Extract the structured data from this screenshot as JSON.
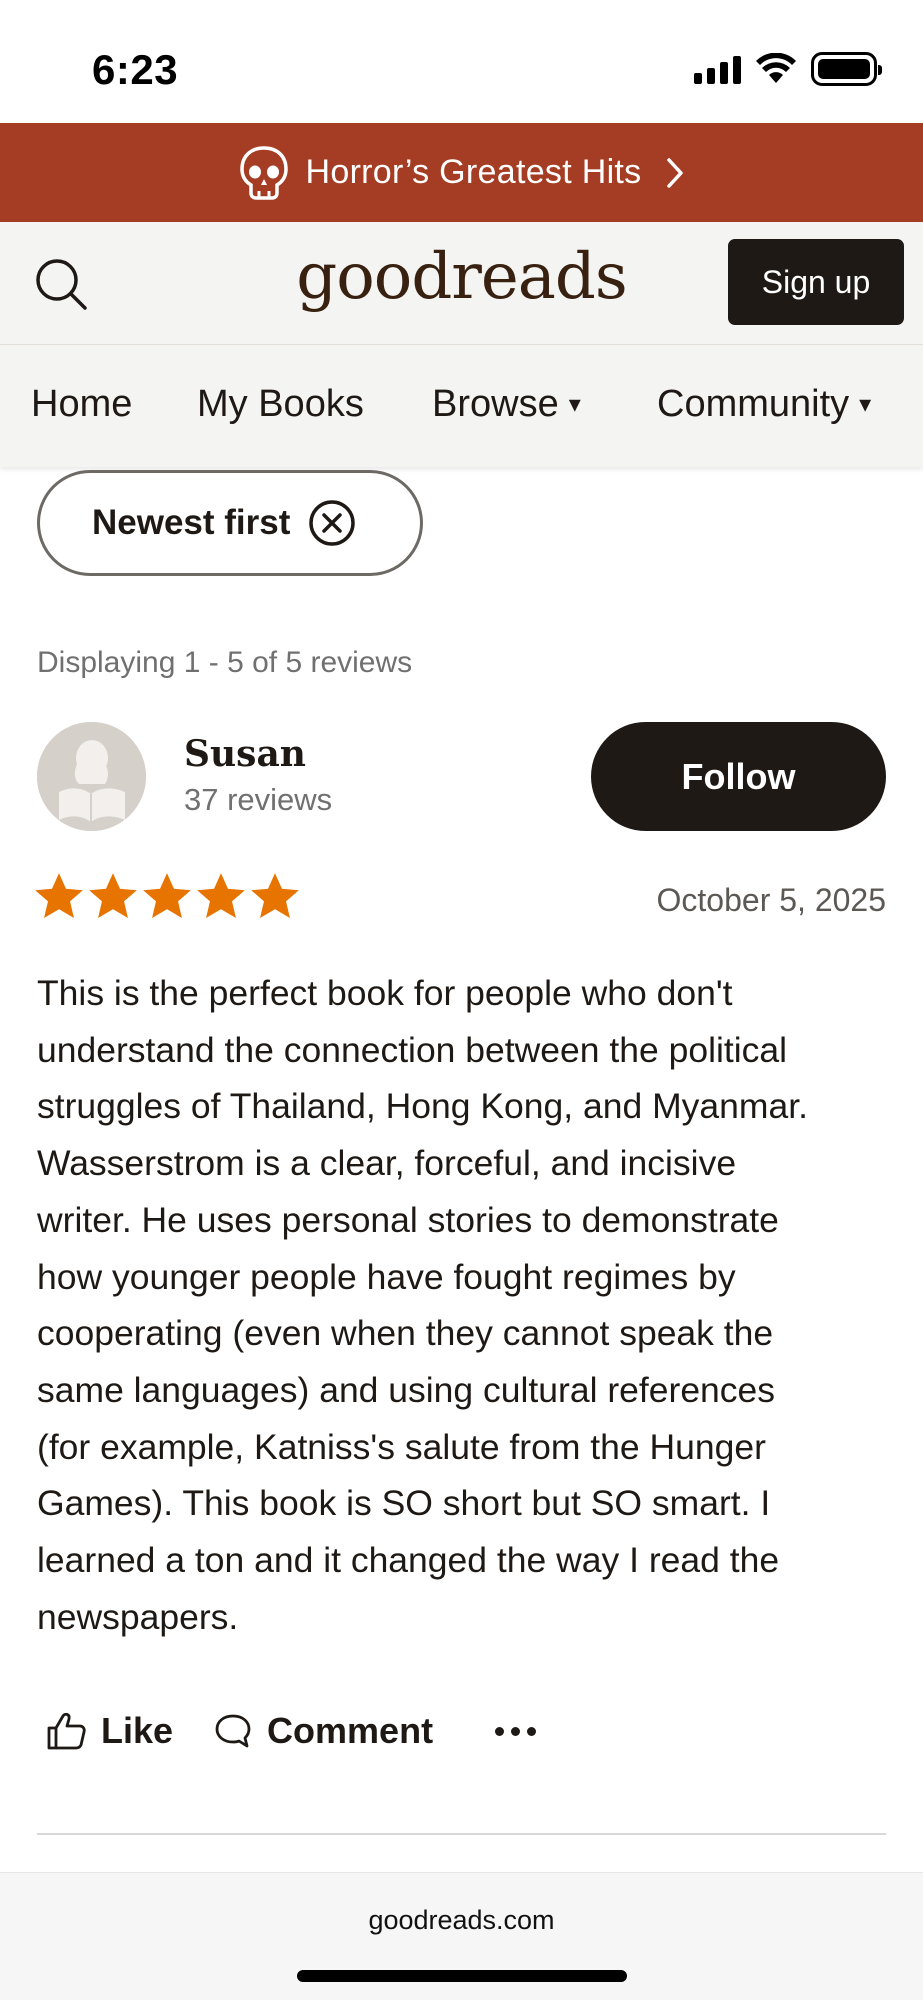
{
  "status_bar": {
    "time": "6:23"
  },
  "promo": {
    "label": "Horror’s Greatest Hits",
    "icon": "skull-icon",
    "color": "#a53d25"
  },
  "header": {
    "logo": "goodreads",
    "signup_label": "Sign up"
  },
  "nav": {
    "items": [
      {
        "label": "Home"
      },
      {
        "label": "My Books"
      },
      {
        "label": "Browse",
        "caret": "▾"
      },
      {
        "label": "Community",
        "caret": "▾"
      }
    ]
  },
  "filter": {
    "sort_label": "Newest first"
  },
  "reviews_count_text": "Displaying 1 - 5 of 5 reviews",
  "review": {
    "reviewer_name": "Susan",
    "reviewer_reviews": "37 reviews",
    "follow_label": "Follow",
    "rating": 5,
    "rating_max": 5,
    "star_color": "#e87400",
    "date": "October 5, 2025",
    "text_lines": [
      "This is the perfect book for people who don't",
      "understand the connection between the political",
      "struggles of Thailand, Hong Kong, and Myanmar.",
      "Wasserstrom is a clear, forceful, and incisive",
      "writer. He uses personal stories to demonstrate",
      "how younger people have fought regimes by",
      "cooperating (even when they cannot speak the",
      "same languages) and using cultural references",
      "(for example, Katniss's salute from the Hunger",
      "Games). This book is SO short but SO smart. I",
      "learned a ton and it changed the way I read the",
      "newspapers."
    ],
    "like_label": "Like",
    "comment_label": "Comment"
  },
  "browser": {
    "url": "goodreads.com"
  }
}
